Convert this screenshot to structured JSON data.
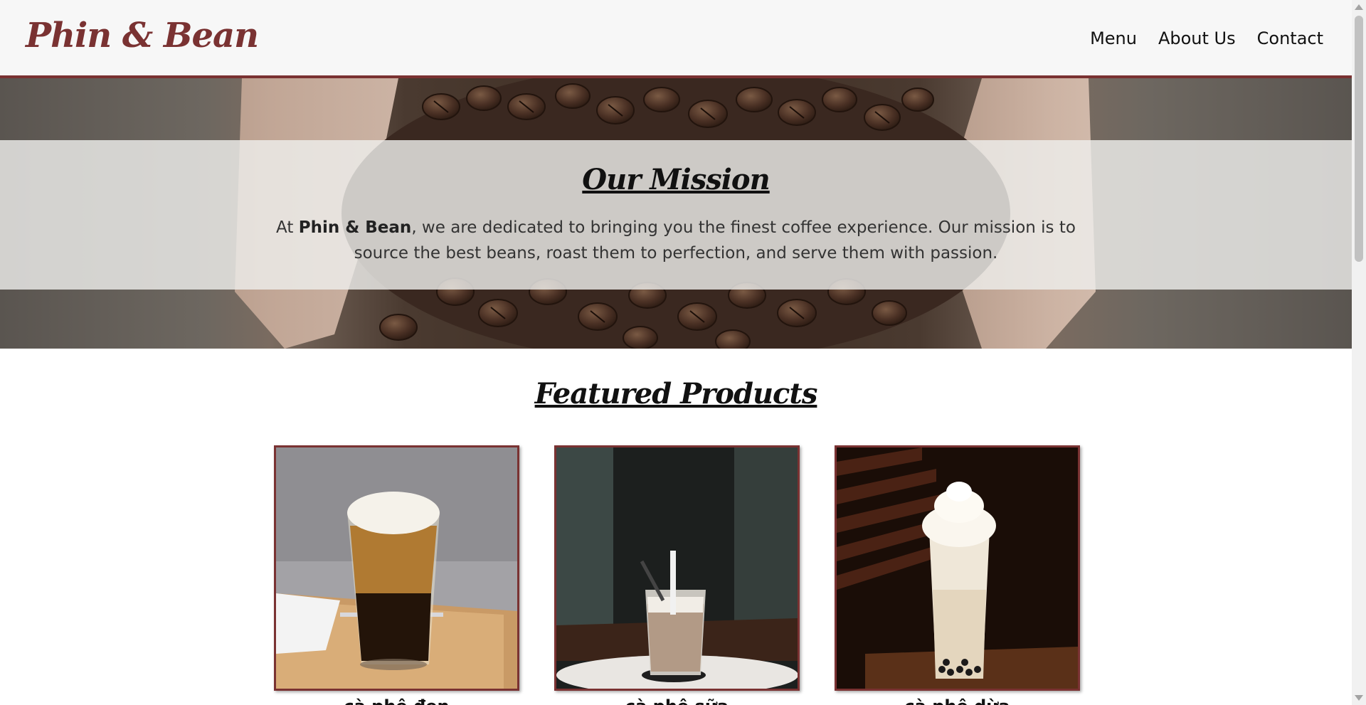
{
  "header": {
    "logo": "Phin & Bean",
    "nav": [
      "Menu",
      "About Us",
      "Contact"
    ]
  },
  "hero": {
    "title": "Our Mission",
    "text_prefix": "At ",
    "text_brand": "Phin & Bean",
    "text_suffix": ", we are dedicated to bringing you the finest coffee experience. Our mission is to source the best beans, roast them to perfection, and serve them with passion."
  },
  "featured": {
    "title": "Featured Products",
    "products": [
      {
        "name": "cà phê đen",
        "image": "iced-black-coffee-image"
      },
      {
        "name": "cà phê sữa",
        "image": "iced-milk-coffee-image"
      },
      {
        "name": "cà phê dừa",
        "image": "coconut-coffee-image"
      }
    ]
  },
  "colors": {
    "accent": "#7a3232",
    "header_bg": "#f7f7f7"
  }
}
